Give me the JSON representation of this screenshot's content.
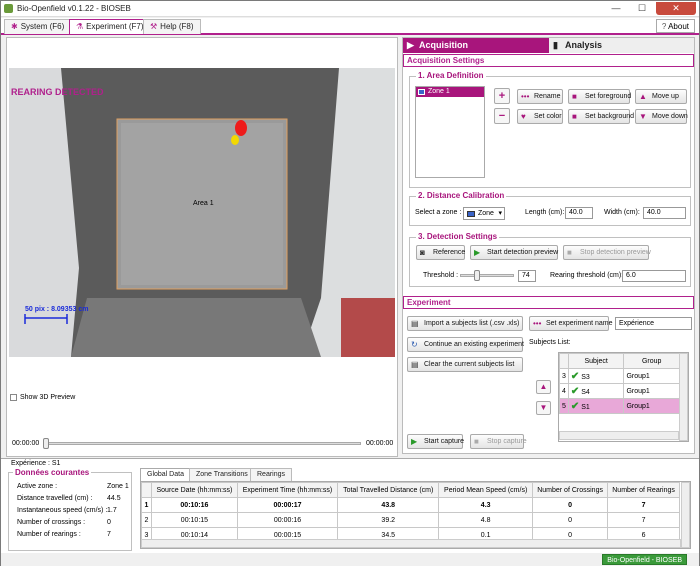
{
  "window": {
    "title": "Bio-Openfield v0.1.22 - BIOSEB",
    "min": "—",
    "max": "☐",
    "close": "✕"
  },
  "menu": {
    "system": "System (F6)",
    "experiment": "Experiment (F7)",
    "help": "Help (F8)",
    "about": "About"
  },
  "video": {
    "rearing_label": "REARING DETECTED",
    "area_label": "Area 1",
    "scale_label": "50 pix : 8.09353 cm",
    "show3d": "Show 3D Preview",
    "time_start": "00:00:00",
    "time_end": "00:00:00",
    "position": 0
  },
  "panel": {
    "tab_acquisition": "Acquisition",
    "tab_analysis": "Analysis",
    "acq_settings": "Acquisition Settings",
    "area_def": {
      "title": "1. Area Definition",
      "zones": [
        "Zone 1"
      ],
      "rename": "Rename",
      "set_color": "Set color",
      "set_foreground": "Set foreground",
      "set_background": "Set background",
      "move_up": "Move up",
      "move_down": "Move down"
    },
    "distance": {
      "title": "2. Distance Calibration",
      "select_zone": "Select a zone :",
      "zone_value": "Zone",
      "length_label": "Length (cm):",
      "length": "40.0",
      "width_label": "Width (cm):",
      "width": "40.0"
    },
    "detection": {
      "title": "3. Detection Settings",
      "reference": "Reference",
      "start_preview": "Start detection preview",
      "stop_preview": "Stop detection preview",
      "threshold_label": "Threshold :",
      "threshold": "74",
      "threshold_level": 74,
      "rearing_label": "Rearing threshold (cm):",
      "rearing": "6.0"
    },
    "experiment": {
      "title": "Experiment",
      "import": "Import a subjects list  (.csv .xls)",
      "set_name": "Set experiment name",
      "name_value": "Expérience",
      "continue": "Continue an existing experiment",
      "clear": "Clear the current subjects list",
      "subjects_list": "Subjects List:",
      "headers": [
        "Subject",
        "Group"
      ],
      "rows": [
        {
          "num": "3",
          "subject": "S3",
          "group": "Group1"
        },
        {
          "num": "4",
          "subject": "S4",
          "group": "Group1"
        },
        {
          "num": "5",
          "subject": "S1",
          "group": "Group1"
        }
      ],
      "start_capture": "Start capture",
      "stop_capture": "Stop capture"
    }
  },
  "bottom": {
    "experience": "Expérience : S1",
    "current_title": "Données courantes",
    "current": [
      {
        "label": "Active zone :",
        "value": "Zone 1"
      },
      {
        "label": "Distance travelled (cm) :",
        "value": "44.5"
      },
      {
        "label": "Instantaneous speed (cm/s) :",
        "value": "1.7"
      },
      {
        "label": "Number of crossings :",
        "value": "0"
      },
      {
        "label": "Number of rearings :",
        "value": "7"
      }
    ],
    "tabs": [
      "Global Data",
      "Zone Transitions",
      "Rearings"
    ],
    "headers": [
      "Source Date (hh:mm:ss)",
      "Experiment Time (hh:mm:ss)",
      "Total Travelled Distance (cm)",
      "Period Mean Speed (cm/s)",
      "Number of Crossings",
      "Number of Rearings"
    ],
    "rows": [
      {
        "num": "1",
        "cells": [
          "00:10:16",
          "00:00:17",
          "43.8",
          "4.3",
          "0",
          "7"
        ]
      },
      {
        "num": "2",
        "cells": [
          "00:10:15",
          "00:00:16",
          "39.2",
          "4.8",
          "0",
          "7"
        ]
      },
      {
        "num": "3",
        "cells": [
          "00:10:14",
          "00:00:15",
          "34.5",
          "0.1",
          "0",
          "6"
        ]
      }
    ]
  },
  "status": {
    "badge": "Bio-Openfield - BIOSEB"
  },
  "colors": {
    "accent": "#a8157c",
    "rearing": "#b0208c",
    "ok": "#2a9a2a"
  }
}
